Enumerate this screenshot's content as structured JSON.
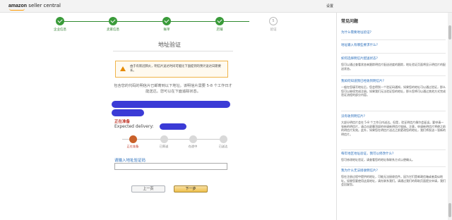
{
  "header": {
    "brand": "amazon",
    "product": "seller central",
    "settings_label": "设置"
  },
  "steps": [
    {
      "label": "企业信息",
      "state": "done"
    },
    {
      "label": "卖家信息",
      "state": "done"
    },
    {
      "label": "账单",
      "state": "done"
    },
    {
      "label": "店铺",
      "state": "done"
    },
    {
      "label": "验证",
      "state": "pending",
      "number": "5"
    }
  ],
  "main": {
    "title": "地址验证",
    "alert_text": "由于有新冠肺炎，明信片送达时间可能比下面提到的预计送达日期要长。",
    "notice": "包含您的代码的明信片已邮寄到以下地址。该明信片需要 5-8 个工作日才能送达。您可以在下面追踪状态。",
    "status_cn": "正在准备",
    "delivery_label": "Expected delivery:",
    "tracker": [
      {
        "label": "正在准备",
        "active": true
      },
      {
        "label": "已寄送",
        "active": false
      },
      {
        "label": "在途中",
        "active": false
      },
      {
        "label": "已送达",
        "active": false
      }
    ],
    "input_label": "请输入地址验证码",
    "input_value": "",
    "prev_button": "上一页",
    "next_button": "下一步"
  },
  "faq": {
    "title": "常见问题",
    "items": [
      {
        "q": "为什么需要地址验证?",
        "a": ""
      },
      {
        "q": "地址输入有哪些要求什么?",
        "a": ""
      },
      {
        "q": "如何选择明信片配送状态?",
        "a": "您可以通过查看状态来跟踪明信片配送进度的跟踪，地址验证页面将显示明信片的配送状态。"
      },
      {
        "q": "我如何知道我已经收到明信片?",
        "a": "一般在您填写地址后，您会得到一个验证码通知，如果您的地址可以通过验证，那么您可以继续完成注册。如果我们无法验证您的地址，那么您将可以通过其他方式完成验证流程的部分内容。"
      },
      {
        "q": "没有收到明信片?",
        "a": "大部分明信片会在 5-8 个工作日内送达。但是，验证明信片偶尔会延误。要申请一张新的明信片，请点击屏幕顶部的申请新明信片链接。注意，申请新明信片将使之前的明信片失效。此外，如果您在明信片送达之前更改您的地址，我们将发送一张新的明信片。"
      },
      {
        "q": "每年地区地址验证，我可以修改什么?",
        "a": "您可修改地址验证，请查看您的地址和联系方式以便确认。"
      },
      {
        "q": "我为什么无法接收明信片?",
        "a": "您在注册过程中提供的地址，可能无法接收信件。因为它们是邮政信箱或者类似地址。如果您要使用这类地址，请先联系我们。请通过我们的帮助页面提交申请，我们会回复您。"
      }
    ]
  }
}
